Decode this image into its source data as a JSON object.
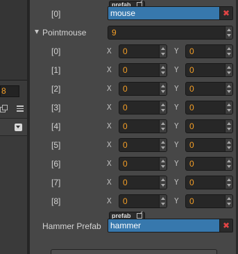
{
  "inspector": {
    "first_entry": {
      "index_label": "[0]",
      "badge_label": "prefab",
      "value": "mouse",
      "clear_label": "✖"
    },
    "pointmouse": {
      "label": "Pointmouse",
      "count": "9",
      "x_axis": "X",
      "y_axis": "Y",
      "items": [
        {
          "index": "[0]",
          "x": "0",
          "y": "0"
        },
        {
          "index": "[1]",
          "x": "0",
          "y": "0"
        },
        {
          "index": "[2]",
          "x": "0",
          "y": "0"
        },
        {
          "index": "[3]",
          "x": "0",
          "y": "0"
        },
        {
          "index": "[4]",
          "x": "0",
          "y": "0"
        },
        {
          "index": "[5]",
          "x": "0",
          "y": "0"
        },
        {
          "index": "[6]",
          "x": "0",
          "y": "0"
        },
        {
          "index": "[7]",
          "x": "0",
          "y": "0"
        },
        {
          "index": "[8]",
          "x": "0",
          "y": "0"
        }
      ]
    },
    "hammer_prefab": {
      "label": "Hammer Prefab",
      "badge_label": "prefab",
      "value": "hammer",
      "clear_label": "✖"
    }
  },
  "left_panel": {
    "number_value": "8"
  },
  "colors": {
    "number_text": "#f59f27",
    "asset_field": "#3778ad",
    "clear_icon": "#e24444"
  }
}
